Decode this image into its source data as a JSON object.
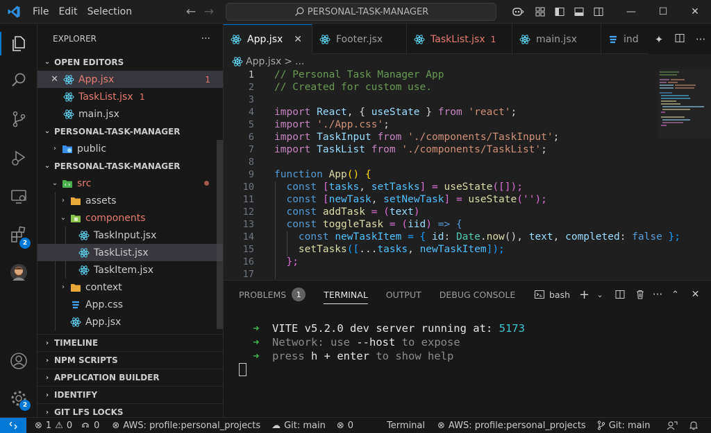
{
  "titlebar": {
    "menu": [
      "File",
      "Edit",
      "Selection"
    ],
    "search": "PERSONAL-TASK-MANAGER"
  },
  "activity": {
    "extensions_badge": "2",
    "manage_badge": "2"
  },
  "sidebar": {
    "title": "EXPLORER",
    "more": "···",
    "open_editors_label": "OPEN EDITORS",
    "open_editors": [
      {
        "name": "App.jsx",
        "count": "1"
      },
      {
        "name": "TaskList.jsx",
        "count": "1"
      },
      {
        "name": "main.jsx",
        "count": ""
      }
    ],
    "folder1_label": "PERSONAL-TASK-MANAGER",
    "folder1_items": [
      {
        "name": "public"
      }
    ],
    "folder2_label": "PERSONAL-TASK-MANAGER",
    "tree": {
      "src": "src",
      "assets": "assets",
      "components": "components",
      "task_input": "TaskInput.jsx",
      "task_list": "TaskList.jsx",
      "task_item": "TaskItem.jsx",
      "context": "context",
      "app_css": "App.css",
      "app_jsx": "App.jsx"
    },
    "sections": [
      "TIMELINE",
      "NPM SCRIPTS",
      "APPLICATION BUILDER",
      "IDENTIFY",
      "GIT LFS LOCKS"
    ]
  },
  "tabs": [
    {
      "name": "App.jsx",
      "count": ""
    },
    {
      "name": "Footer.jsx",
      "count": ""
    },
    {
      "name": "TaskList.jsx",
      "count": "1"
    },
    {
      "name": "main.jsx",
      "count": ""
    },
    {
      "name": "ind",
      "count": ""
    }
  ],
  "breadcrumb": {
    "file": "App.jsx",
    "sep": ">",
    "rest": "..."
  },
  "editor": {
    "line_numbers": [
      "1",
      "2",
      "3",
      "4",
      "5",
      "6",
      "7",
      "8",
      "9",
      "10",
      "11",
      "12",
      "13",
      "14",
      "15",
      "16",
      "17"
    ],
    "line1": "// Personal Task Manager App",
    "line2": "// Created for custom use.",
    "import_kw": "import",
    "from_kw": "from",
    "l5_ident": "React",
    "l5_mid": ", { ",
    "l5_usestate": "useState",
    "l5_close": " } ",
    "l5_str": "'react'",
    "semi": ";",
    "l6_str": "'./App.css'",
    "l7_ident": "TaskInput",
    "l7_str": "'./components/TaskInput'",
    "l8_ident": "TaskList",
    "l8_str": "'./components/TaskList'",
    "function_kw": "function",
    "l10_fn": "App",
    "l10_rest": "() {",
    "const_kw": "const",
    "l11_a": "[",
    "l11_tasks": "tasks",
    "l11_comma": ", ",
    "l11_set": "setTasks",
    "l11_b": "] = ",
    "l11_call": "useState",
    "l11_args": "([]);",
    "l12_newtask": "newTask",
    "l12_set": "setNewTask",
    "l12_args": "('');",
    "l13_add": "addTask",
    "l13_eq": " = (",
    "l13_param": "text",
    "l13_close": ")",
    "l14_toggle": "toggleTask",
    "l14_param": "iid",
    "l14_arrow": " => {",
    "l15_item": "newTaskItem",
    "l15_eq": " = { ",
    "l15_id": "id",
    "l15_colon": ": ",
    "l15_date": "Date",
    "l15_now": "now",
    "l15_paren": "(), ",
    "l15_text": "text",
    "l15_comma": ", ",
    "l15_completed": "completed",
    "l15_false": "false",
    "l15_end": " };",
    "l16_set": "setTasks",
    "l16_open": "([",
    "l16_spread": "...",
    "l16_tasks": "tasks",
    "l16_comma": ", ",
    "l16_item": "newTaskItem",
    "l16_end": "]);",
    "l17": "};"
  },
  "panel": {
    "tabs": [
      "PROBLEMS",
      "TERMINAL",
      "OUTPUT",
      "DEBUG CONSOLE"
    ],
    "problems_count": "1",
    "more": "···",
    "shell": "bash",
    "terminal": {
      "arrow": "➜",
      "l1_a": "VITE v5.2.0",
      "l1_b": " dev server running at: ",
      "l1_port": "5173",
      "l2_a": "Network:",
      "l2_b": " use ",
      "l2_c": "--host",
      "l2_d": " to expose",
      "l3_a": "press ",
      "l3_b": "h + enter",
      "l3_c": " to show help"
    }
  },
  "statusbar": {
    "errors": "1",
    "warnings": "0",
    "ports": "0",
    "aws_left": "AWS: profile:personal_projects",
    "git_left": "Git: main",
    "sync": "0",
    "terminal": "Terminal",
    "aws_right": "AWS: profile:personal_projects",
    "git_right": "Git: main"
  },
  "colors": {
    "accent": "#0078d4",
    "modified": "#e77b71",
    "react_icon": "#61dafb"
  }
}
